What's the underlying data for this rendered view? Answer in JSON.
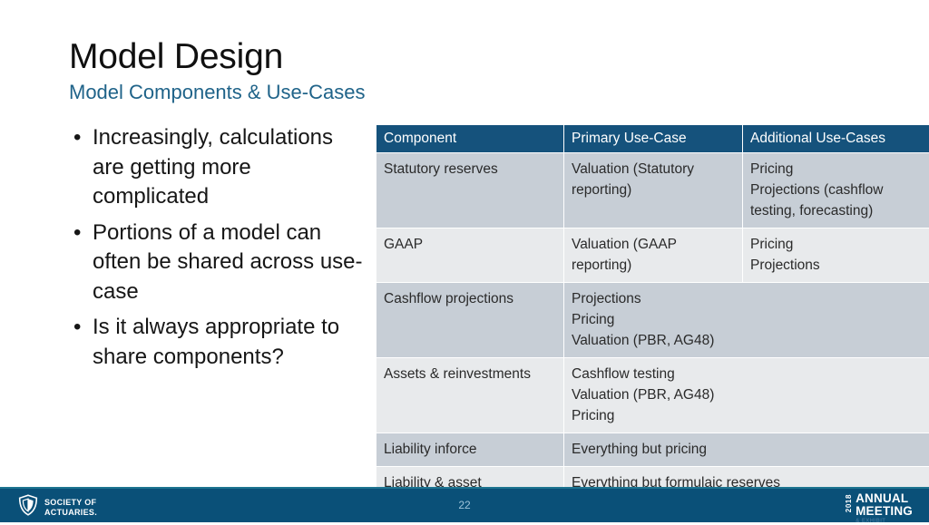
{
  "slide": {
    "title": "Model Design",
    "subtitle": "Model Components & Use-Cases"
  },
  "bullets": [
    {
      "marker": "•",
      "text": "Increasingly, calculations are getting more complicated"
    },
    {
      "marker": "•",
      "text": "Portions of a model can often be shared across use-case"
    },
    {
      "marker": "•",
      "text": "Is it always appropriate to share components?"
    }
  ],
  "table": {
    "headers": [
      "Component",
      "Primary Use-Case",
      "Additional Use-Cases"
    ],
    "rows": [
      {
        "component": "Statutory reserves",
        "primary": [
          "Valuation (Statutory",
          "reporting)"
        ],
        "additional": [
          "Pricing",
          "Projections (cashflow",
          "testing, forecasting)"
        ],
        "merged": false,
        "shade": "dark"
      },
      {
        "component": "GAAP",
        "primary": [
          "Valuation (GAAP",
          "reporting)"
        ],
        "additional": [
          "Pricing",
          "Projections"
        ],
        "merged": false,
        "shade": "light"
      },
      {
        "component": "Cashflow projections",
        "primary": [
          "Projections",
          "Pricing",
          "Valuation (PBR, AG48)"
        ],
        "additional": [],
        "merged": true,
        "shade": "dark"
      },
      {
        "component": "Assets & reinvestments",
        "primary": [
          "Cashflow testing",
          "Valuation (PBR, AG48)",
          "Pricing"
        ],
        "additional": [],
        "merged": true,
        "shade": "light"
      },
      {
        "component": "Liability inforce",
        "primary": [
          "Everything but pricing"
        ],
        "additional": [],
        "merged": true,
        "shade": "dark"
      },
      {
        "component": "Liability & asset assumptions",
        "primary": [
          "Everything but formulaic reserves"
        ],
        "additional": [],
        "merged": true,
        "shade": "light"
      }
    ]
  },
  "footer": {
    "organization": {
      "line1": "SOCIETY OF",
      "line2": "ACTUARIES."
    },
    "page_number": "22",
    "meeting": {
      "year": "2018",
      "word1": "ANNUAL",
      "word2": "MEETING",
      "sub": "& EXHIBIT"
    }
  },
  "colors": {
    "header_navy": "#15527c",
    "subtitle_blue": "#1f6389",
    "row_dark": "#c7ced6",
    "row_light": "#e8eaec",
    "footer_blue": "#0a5078",
    "footer_accent": "#1d7490"
  }
}
